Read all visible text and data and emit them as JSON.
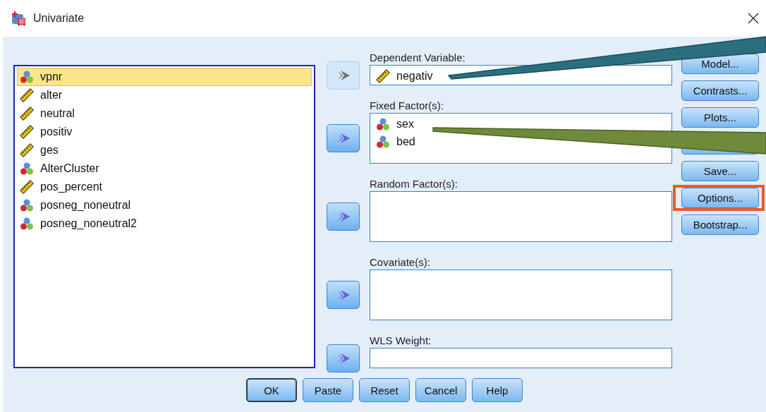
{
  "window": {
    "title": "Univariate"
  },
  "variables": [
    {
      "name": "vpnr",
      "kind": "nominal",
      "selected": true
    },
    {
      "name": "alter",
      "kind": "scale",
      "selected": false
    },
    {
      "name": "neutral",
      "kind": "scale",
      "selected": false
    },
    {
      "name": "positiv",
      "kind": "scale",
      "selected": false
    },
    {
      "name": "ges",
      "kind": "scale",
      "selected": false
    },
    {
      "name": "AlterCluster",
      "kind": "nominal",
      "selected": false
    },
    {
      "name": "pos_percent",
      "kind": "scale",
      "selected": false
    },
    {
      "name": "posneg_noneutral",
      "kind": "nominal",
      "selected": false
    },
    {
      "name": "posneg_noneutral2",
      "kind": "nominal",
      "selected": false
    }
  ],
  "target_lists": [
    {
      "label": "Dependent Variable:",
      "kind": "single",
      "arrow_disabled": true,
      "items": [
        {
          "name": "negativ",
          "kind": "scale"
        }
      ]
    },
    {
      "label": "Fixed Factor(s):",
      "kind": "multi",
      "arrow_disabled": false,
      "items": [
        {
          "name": "sex",
          "kind": "nominal"
        },
        {
          "name": "bed",
          "kind": "nominal"
        }
      ]
    },
    {
      "label": "Random Factor(s):",
      "kind": "multi",
      "arrow_disabled": false
    },
    {
      "label": "Covariate(s):",
      "kind": "multi",
      "arrow_disabled": false
    },
    {
      "label": "WLS Weight:",
      "kind": "single",
      "arrow_disabled": false
    }
  ],
  "side_buttons": [
    {
      "kind": "button",
      "label": "Model...",
      "highlighted": false
    },
    {
      "kind": "button",
      "label": "Contrasts...",
      "highlighted": false
    },
    {
      "kind": "button",
      "label": "Plots...",
      "highlighted": false
    },
    {
      "kind": "covered"
    },
    {
      "kind": "button",
      "label": "Save...",
      "highlighted": false
    },
    {
      "kind": "button",
      "label": "Options...",
      "highlighted": true
    },
    {
      "kind": "button",
      "label": "Bootstrap...",
      "highlighted": false
    }
  ],
  "bottom_buttons": [
    {
      "label": "OK",
      "default": true
    },
    {
      "label": "Paste",
      "default": false
    },
    {
      "label": "Reset",
      "default": false
    },
    {
      "label": "Cancel",
      "default": false
    },
    {
      "label": "Help",
      "default": false
    }
  ]
}
